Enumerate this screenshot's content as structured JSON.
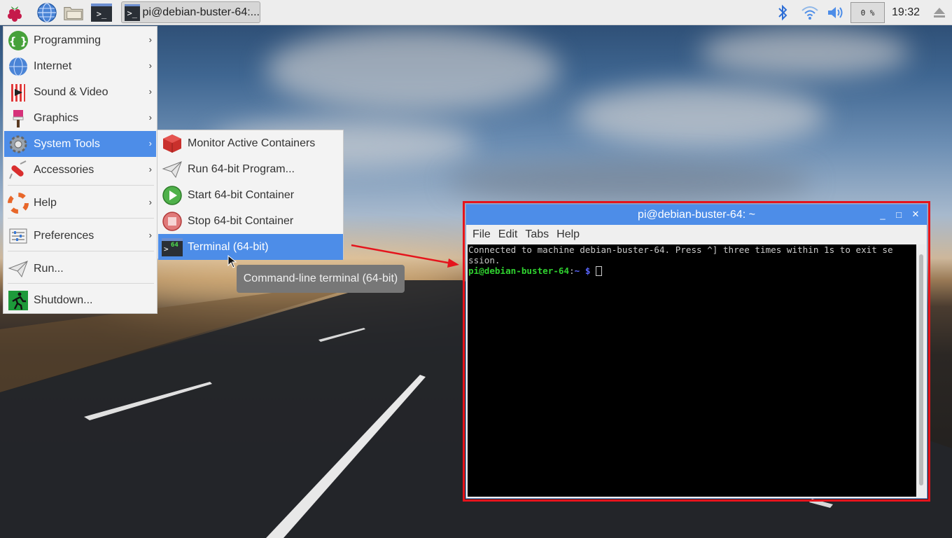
{
  "taskbar": {
    "launchers": [
      "raspberry-menu",
      "web-browser",
      "file-manager",
      "terminal"
    ],
    "task_button_label": "pi@debian-buster-64:...",
    "task_icon_text": ">_",
    "cpu_usage": "0 %",
    "clock": "19:32"
  },
  "main_menu": {
    "items": [
      {
        "label": "Programming",
        "icon": "programming-icon"
      },
      {
        "label": "Internet",
        "icon": "globe-icon"
      },
      {
        "label": "Sound & Video",
        "icon": "film-icon"
      },
      {
        "label": "Graphics",
        "icon": "paintbrush-icon"
      },
      {
        "label": "System Tools",
        "icon": "gear-icon"
      },
      {
        "label": "Accessories",
        "icon": "knife-icon"
      },
      {
        "label": "Help",
        "icon": "lifebuoy-icon"
      },
      {
        "label": "Preferences",
        "icon": "preferences-icon"
      },
      {
        "label": "Run...",
        "icon": "paper-plane-icon"
      },
      {
        "label": "Shutdown...",
        "icon": "exit-icon"
      }
    ]
  },
  "submenu": {
    "items": [
      {
        "label": "Monitor Active Containers",
        "icon": "container-icon"
      },
      {
        "label": "Run 64-bit Program...",
        "icon": "paper-plane-icon"
      },
      {
        "label": "Start 64-bit Container",
        "icon": "play-icon"
      },
      {
        "label": "Stop 64-bit Container",
        "icon": "stop-icon"
      },
      {
        "label": "Terminal (64-bit)",
        "icon": "terminal-64-icon"
      }
    ],
    "terminal_icon_text": "64"
  },
  "tooltip": "Command-line terminal (64-bit)",
  "terminal": {
    "title": "pi@debian-buster-64: ~",
    "menus": [
      "File",
      "Edit",
      "Tabs",
      "Help"
    ],
    "output_line1": "Connected to machine debian-buster-64. Press ^] three times within 1s to exit se",
    "output_line2": "ssion.",
    "prompt_user": "pi@debian-buster-64",
    "prompt_sep": ":",
    "prompt_path": "~",
    "prompt_symbol": " $ ",
    "window_controls": {
      "minimize": "_",
      "maximize": "□",
      "close": "✕"
    }
  },
  "colors": {
    "menu_highlight": "#4d8de8",
    "annotation_red": "#e5141c",
    "prompt_green": "#2fd12f",
    "prompt_blue": "#5a66ff"
  }
}
